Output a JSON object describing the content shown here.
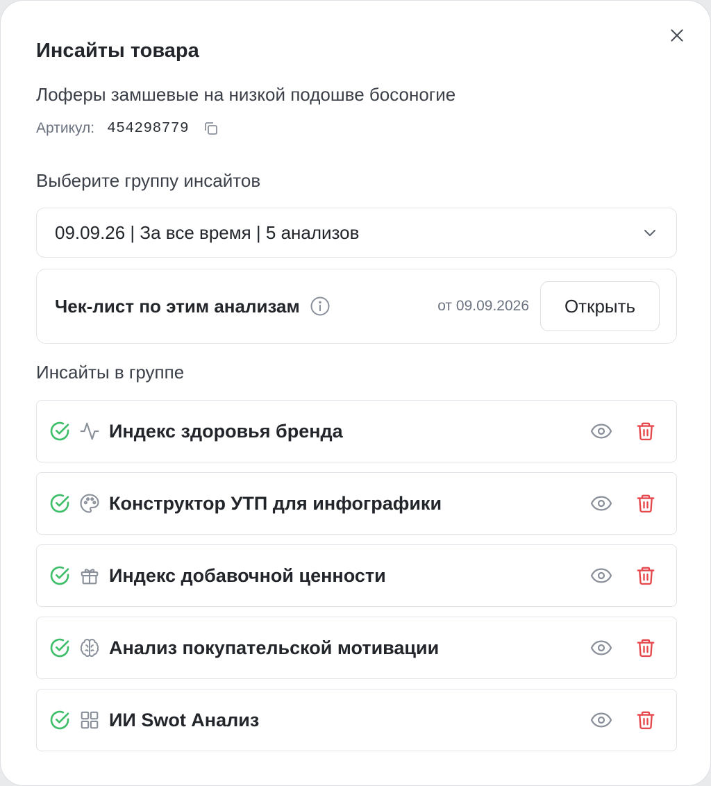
{
  "modal": {
    "title": "Инсайты товара",
    "product_name": "Лоферы замшевые на низкой подошве босоногие",
    "article_label": "Артикул:",
    "article_value": "454298779"
  },
  "group_section": {
    "label": "Выберите группу инсайтов",
    "selected": "09.09.26 | За все время | 5 анализов"
  },
  "checklist": {
    "label": "Чек-лист по этим анализам",
    "date": "от 09.09.2026",
    "open_label": "Открыть"
  },
  "insights_section": {
    "label": "Инсайты в группе",
    "items": [
      {
        "name": "Индекс здоровья бренда",
        "icon": "activity-icon"
      },
      {
        "name": "Конструктор УТП для инфографики",
        "icon": "palette-icon"
      },
      {
        "name": "Индекс добавочной ценности",
        "icon": "gift-icon"
      },
      {
        "name": "Анализ покупательской мотивации",
        "icon": "brain-icon"
      },
      {
        "name": "ИИ Swot Анализ",
        "icon": "grid-icon"
      }
    ]
  },
  "colors": {
    "success": "#3fbf6a",
    "danger": "#e5484d",
    "muted_icon": "#8a9099"
  }
}
